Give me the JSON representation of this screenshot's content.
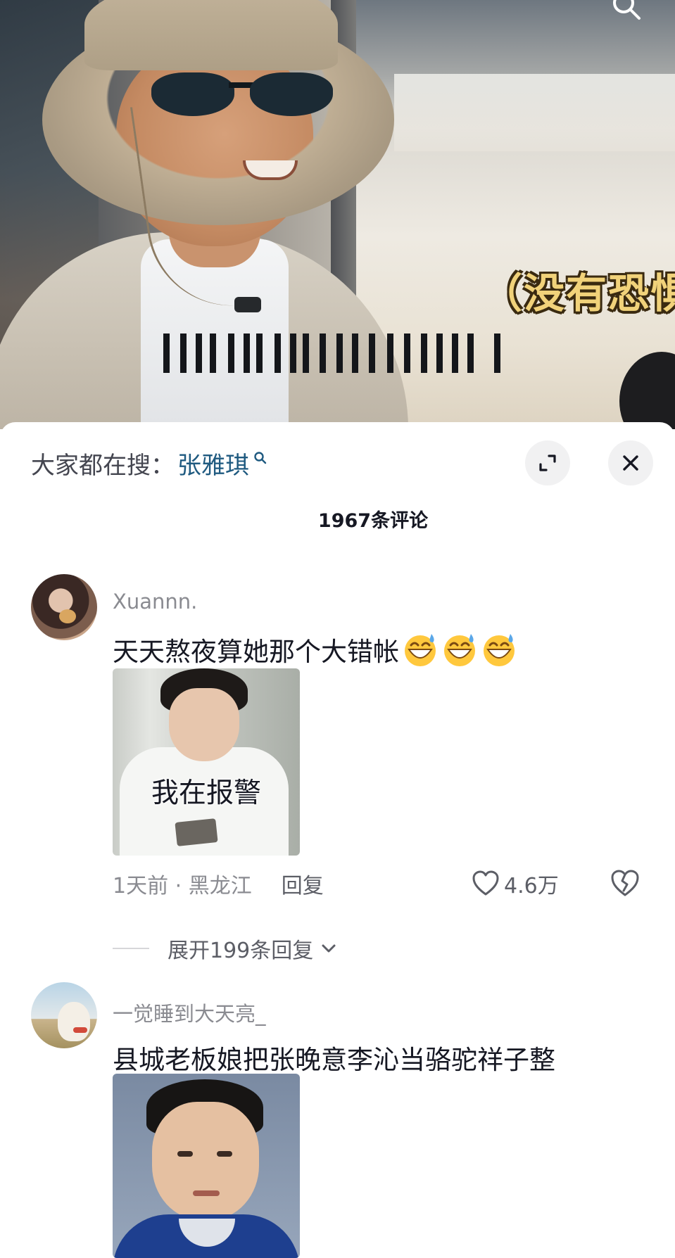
{
  "video": {
    "subtitle": "（没有恐惧感"
  },
  "hot_search": {
    "label": "大家都在搜：",
    "term": "张雅琪"
  },
  "comments_header": {
    "count_label": "1967条评论"
  },
  "comments": [
    {
      "username": "Xuannn.",
      "text": "天天熬夜算她那个大错帐",
      "emoji": "sweat-grin-emoji",
      "emoji_count": 3,
      "image_caption": "我在报警",
      "time_location": "1天前 · 黑龙江",
      "reply_label": "回复",
      "likes": "4.6万",
      "expand_replies": "展开199条回复"
    },
    {
      "username": "一觉睡到大天亮_",
      "text": "县城老板娘把张晚意李沁当骆驼祥子整"
    }
  ],
  "icons": {
    "search": "search-icon",
    "expand": "expand-icon",
    "close": "close-icon",
    "like": "heart-icon",
    "dislike": "broken-heart-icon",
    "chevron": "chevron-down-icon"
  },
  "colors": {
    "hot_search_term": "#1f5a80",
    "subtitle": "#f1d27a",
    "meta_text": "#8a8b91"
  }
}
